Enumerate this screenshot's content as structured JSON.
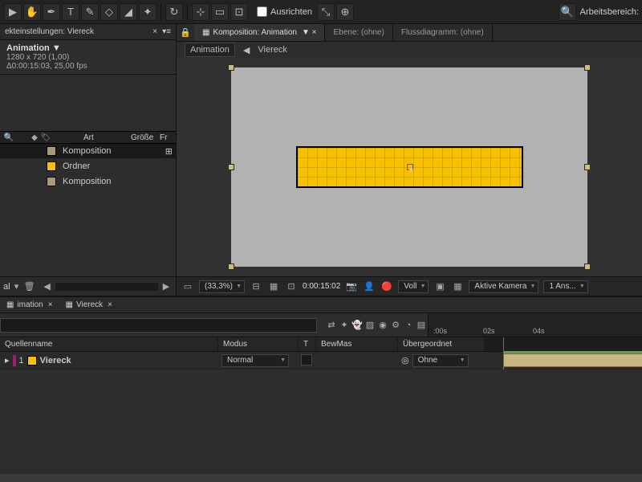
{
  "toolbar": {
    "align_label": "Ausrichten",
    "workspace_label": "Arbeitsbereich:"
  },
  "project": {
    "panel_tab": "ekteinstellungen: Viereck",
    "title": "Animation ▼",
    "dims": "1280 x 720 (1,00)",
    "time": "Δ0:00:15:03, 25,00 fps",
    "columns": {
      "art": "Art",
      "size": "Größe",
      "fr": "Fr"
    },
    "rows": [
      {
        "name": "Komposition",
        "color": "#a69a7b",
        "sel": true
      },
      {
        "name": "Ordner",
        "color": "#f7c100",
        "sel": false
      },
      {
        "name": "Komposition",
        "color": "#a69a7b",
        "sel": false
      }
    ],
    "footer_label": "al"
  },
  "viewer": {
    "tab_comp": "Komposition: Animation",
    "tab_layer": "Ebene: (ohne)",
    "tab_flow": "Flussdiagramm: (ohne)",
    "bc_active": "Animation",
    "bc_other": "Viereck",
    "footer": {
      "zoom": "(33,3%)",
      "time": "0:00:15:02",
      "fill": "Voll",
      "camera": "Aktive Kamera",
      "view": "1 Ans..."
    }
  },
  "timeline": {
    "tabs": {
      "t1": "imation",
      "t2": "Viereck"
    },
    "headers": {
      "source": "Quellenname",
      "modus": "Modus",
      "t": "T",
      "bew": "BewMas",
      "parent": "Übergeordnet"
    },
    "ruler": {
      "t0": ":00s",
      "t1": "02s",
      "t2": "04s"
    },
    "layer": {
      "num": "1",
      "name": "Viereck",
      "modus": "Normal",
      "parent": "Ohne"
    }
  },
  "chart_data": {
    "type": "table",
    "note": "Not a chart image"
  }
}
